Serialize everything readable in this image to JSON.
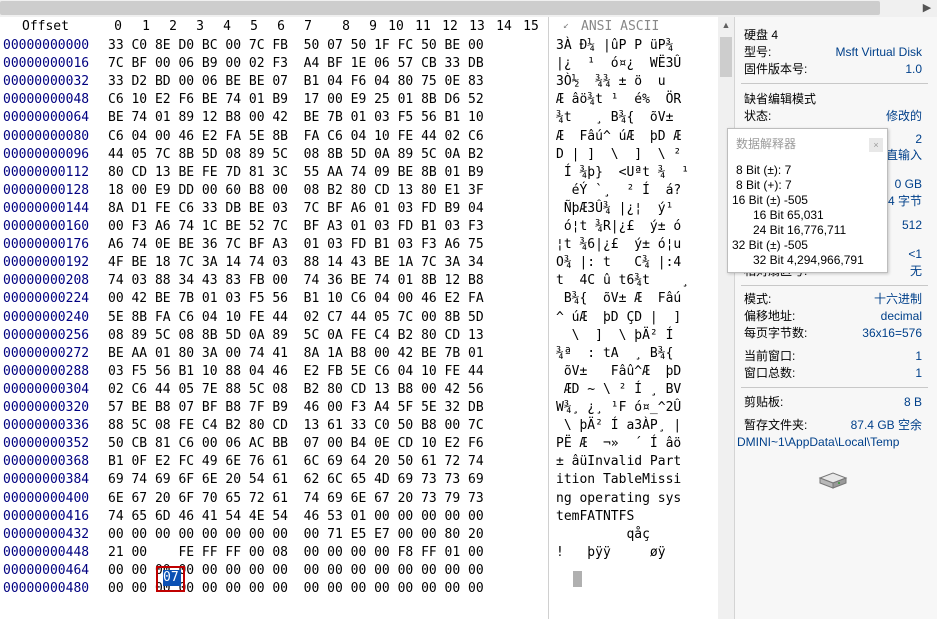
{
  "header": {
    "offset_label": "Offset",
    "columns": [
      "0",
      "1",
      "2",
      "3",
      "4",
      "5",
      "6",
      "7",
      "8",
      "9",
      "10",
      "11",
      "12",
      "13",
      "14",
      "15"
    ],
    "ansi_label": "ANSI ASCII",
    "scroll_right": "▶"
  },
  "rows": [
    {
      "off": "00000000000",
      "hex": "33 C0 8E D0 BC 00 7C FB  50 07 50 1F FC 50 BE 00",
      "asc": "3À Ð¼ |ûP P üP¾"
    },
    {
      "off": "00000000016",
      "hex": "7C BF 00 06 B9 00 02 F3  A4 BF 1E 06 57 CB 33 DB",
      "asc": "|¿  ¹  ó¤¿  WË3Û"
    },
    {
      "off": "00000000032",
      "hex": "33 D2 BD 00 06 BE BE 07  B1 04 F6 04 80 75 0E 83",
      "asc": "3Ò½  ¾¾ ± ö  u  "
    },
    {
      "off": "00000000048",
      "hex": "C6 10 E2 F6 BE 74 01 B9  17 00 E9 25 01 8B D6 52",
      "asc": "Æ âö¾t ¹  é%  ÖR"
    },
    {
      "off": "00000000064",
      "hex": "BE 74 01 89 12 B8 00 42  BE 7B 01 03 F5 56 B1 10",
      "asc": "¾t   ¸ B¾{  õV± "
    },
    {
      "off": "00000000080",
      "hex": "C6 04 00 46 E2 FA 5E 8B  FA C6 04 10 FE 44 02 C6",
      "asc": "Æ  Fâú^ úÆ  þD Æ"
    },
    {
      "off": "00000000096",
      "hex": "44 05 7C 8B 5D 08 89 5C  08 8B 5D 0A 89 5C 0A B2",
      "asc": "D | ]  \\  ]  \\ ²"
    },
    {
      "off": "00000000112",
      "hex": "80 CD 13 BE FE 7D 81 3C  55 AA 74 09 BE 8B 01 B9",
      "asc": " Í ¾þ}  <Uªt ¾  ¹"
    },
    {
      "off": "00000000128",
      "hex": "18 00 E9 DD 00 60 B8 00  08 B2 80 CD 13 80 E1 3F",
      "asc": "  éÝ `¸  ² Í  á?"
    },
    {
      "off": "00000000144",
      "hex": "8A D1 FE C6 33 DB BE 03  7C BF A6 01 03 FD B9 04",
      "asc": " ÑþÆ3Û¾ |¿¦  ý¹ "
    },
    {
      "off": "00000000160",
      "hex": "00 F3 A6 74 1C BE 52 7C  BF A3 01 03 FD B1 03 F3",
      "asc": " ó¦t ¾R|¿£  ý± ó"
    },
    {
      "off": "00000000176",
      "hex": "A6 74 0E BE 36 7C BF A3  01 03 FD B1 03 F3 A6 75",
      "asc": "¦t ¾6|¿£  ý± ó¦u"
    },
    {
      "off": "00000000192",
      "hex": "4F BE 18 7C 3A 14 74 03  88 14 43 BE 1A 7C 3A 34",
      "asc": "O¾ |: t   C¾ |:4"
    },
    {
      "off": "00000000208",
      "hex": "74 03 88 34 43 83 FB 00  74 36 BE 74 01 8B 12 B8",
      "asc": "t  4C û t6¾t    ¸"
    },
    {
      "off": "00000000224",
      "hex": "00 42 BE 7B 01 03 F5 56  B1 10 C6 04 00 46 E2 FA",
      "asc": " B¾{  õV± Æ  Fâú"
    },
    {
      "off": "00000000240",
      "hex": "5E 8B FA C6 04 10 FE 44  02 C7 44 05 7C 00 8B 5D",
      "asc": "^ úÆ  þD ÇD |  ]"
    },
    {
      "off": "00000000256",
      "hex": "08 89 5C 08 8B 5D 0A 89  5C 0A FE C4 B2 80 CD 13",
      "asc": "  \\  ]  \\ þÄ² Í "
    },
    {
      "off": "00000000272",
      "hex": "BE AA 01 80 3A 00 74 41  8A 1A B8 00 42 BE 7B 01",
      "asc": "¾ª  : tA  ¸ B¾{ "
    },
    {
      "off": "00000000288",
      "hex": "03 F5 56 B1 10 88 04 46  E2 FB 5E C6 04 10 FE 44",
      "asc": " õV±   Fâû^Æ  þD"
    },
    {
      "off": "00000000304",
      "hex": "02 C6 44 05 7E 88 5C 08  B2 80 CD 13 B8 00 42 56",
      "asc": " ÆD ~ \\ ² Í ¸ BV"
    },
    {
      "off": "00000000320",
      "hex": "57 BE B8 07 BF B8 7F B9  46 00 F3 A4 5F 5E 32 DB",
      "asc": "W¾¸ ¿¸ ¹F ó¤_^2Û"
    },
    {
      "off": "00000000336",
      "hex": "88 5C 08 FE C4 B2 80 CD  13 61 33 C0 50 B8 00 7C",
      "asc": " \\ þÄ² Í a3ÀP¸ |"
    },
    {
      "off": "00000000352",
      "hex": "50 CB 81 C6 00 06 AC BB  07 00 B4 0E CD 10 E2 F6",
      "asc": "PË Æ  ¬»  ´ Í âö"
    },
    {
      "off": "00000000368",
      "hex": "B1 0F E2 FC 49 6E 76 61  6C 69 64 20 50 61 72 74",
      "asc": "± âüInvalid Part"
    },
    {
      "off": "00000000384",
      "hex": "69 74 69 6F 6E 20 54 61  62 6C 65 4D 69 73 73 69",
      "asc": "ition TableMissi"
    },
    {
      "off": "00000000400",
      "hex": "6E 67 20 6F 70 65 72 61  74 69 6E 67 20 73 79 73",
      "asc": "ng operating sys"
    },
    {
      "off": "00000000416",
      "hex": "74 65 6D 46 41 54 4E 54  46 53 01 00 00 00 00 00",
      "asc": "temFATNTFS      "
    },
    {
      "off": "00000000432",
      "hex": "00 00 00 00 00 00 00 00  00 71 E5 E7 00 00 80 20",
      "asc": "         qåç     "
    },
    {
      "off": "00000000448",
      "hex": "21 00    FE FF FF 00 08  00 00 00 00 F8 FF 01 00",
      "asc": "!   þÿÿ     øÿ  "
    },
    {
      "off": "00000000464",
      "hex": "00 00 00 00 00 00 00 00  00 00 00 00 00 00 00 00",
      "asc": "                "
    },
    {
      "off": "00000000480",
      "hex": "00 00 00 00 00 00 00 00  00 00 00 00 00 00 00 00",
      "asc": "                "
    }
  ],
  "selected_byte": "07",
  "panel": {
    "disk_title": "硬盘 4",
    "model_label": "型号:",
    "model_value": "Msft Virtual Disk",
    "firmware_label": "固件版本号:",
    "firmware_value": "1.0",
    "edit_mode_title": "缺省编辑模式",
    "state_label": "状态:",
    "state_value": "修改的",
    "partial_1": "2",
    "partial_2": "直输入",
    "partial_3": "0 GB",
    "partial_4": "4 字节",
    "partial_5": "512",
    "partial_6": "<1",
    "partial_7": "无",
    "partial_label": "相对扇区号:",
    "mode_label": "模式:",
    "mode_value": "十六进制",
    "offset_addr_label": "偏移地址:",
    "offset_addr_value": "decimal",
    "bytes_per_page_label": "每页字节数:",
    "bytes_per_page_value": "36x16=576",
    "current_window_label": "当前窗口:",
    "current_window_value": "1",
    "total_windows_label": "窗口总数:",
    "total_windows_value": "1",
    "clipboard_label": "剪贴板:",
    "clipboard_value": "8 B",
    "temp_folder_label": "暂存文件夹:",
    "temp_folder_value": "87.4 GB 空余",
    "temp_path": "DMINI~1\\AppData\\Local\\Temp"
  },
  "popup": {
    "title": "数据解释器",
    "close": "×",
    "lines": [
      "8 Bit (±): 7",
      "8 Bit (+): 7",
      "16 Bit (±) -505",
      "16 Bit 65,031",
      "24 Bit 16,776,711",
      "32 Bit (±) -505",
      "32 Bit 4,294,966,791"
    ]
  }
}
